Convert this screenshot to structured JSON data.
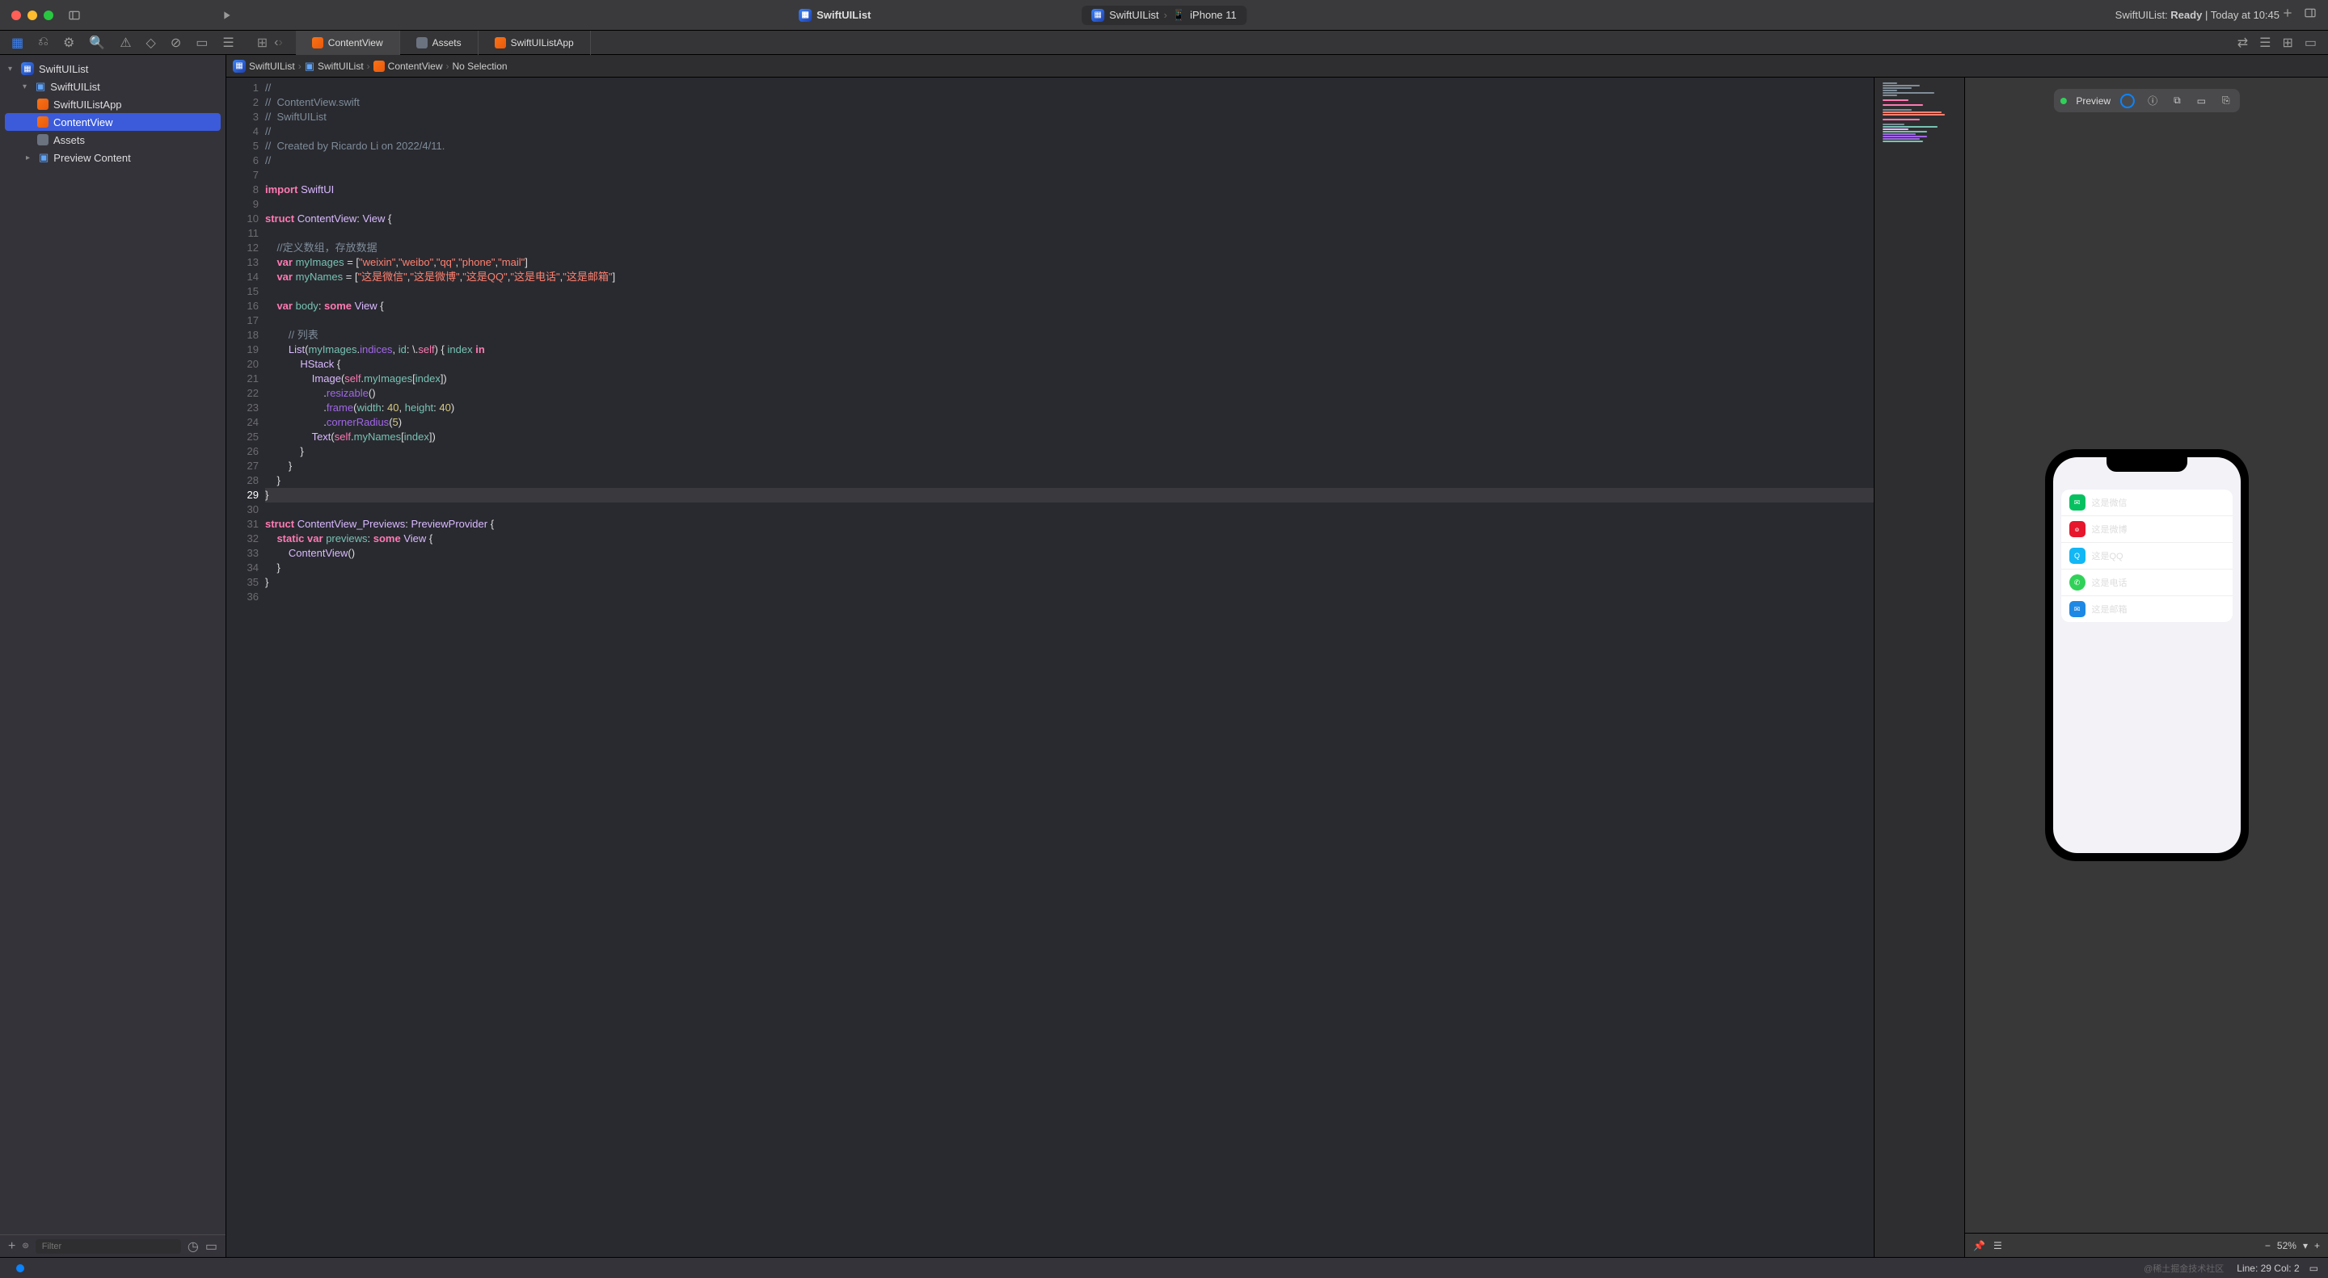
{
  "titlebar": {
    "project_name": "SwiftUIList",
    "scheme": "SwiftUIList",
    "device": "iPhone 11",
    "status_prefix": "SwiftUIList:",
    "status_ready": "Ready",
    "status_time": "| Today at 10:45"
  },
  "tabs": [
    {
      "label": "ContentView",
      "icon": "swift",
      "active": true
    },
    {
      "label": "Assets",
      "icon": "assets",
      "active": false
    },
    {
      "label": "SwiftUIListApp",
      "icon": "swift",
      "active": false
    }
  ],
  "breadcrumb": {
    "items": [
      "SwiftUIList",
      "SwiftUIList",
      "ContentView",
      "No Selection"
    ]
  },
  "navigator": {
    "root": "SwiftUIList",
    "group": "SwiftUIList",
    "files": [
      {
        "name": "SwiftUIListApp",
        "icon": "swift"
      },
      {
        "name": "ContentView",
        "icon": "swift",
        "selected": true
      },
      {
        "name": "Assets",
        "icon": "assets"
      },
      {
        "name": "Preview Content",
        "icon": "folder"
      }
    ],
    "filter_placeholder": "Filter"
  },
  "code": {
    "lines": [
      "//",
      "//  ContentView.swift",
      "//  SwiftUIList",
      "//",
      "//  Created by Ricardo Li on 2022/4/11.",
      "//",
      "",
      "import SwiftUI",
      "",
      "struct ContentView: View {",
      "",
      "    //定义数组，存放数据",
      "    var myImages = [\"weixin\",\"weibo\",\"qq\",\"phone\",\"mail\"]",
      "    var myNames = [\"这是微信\",\"这是微博\",\"这是QQ\",\"这是电话\",\"这是邮箱\"]",
      "",
      "    var body: some View {",
      "",
      "        // 列表",
      "        List(myImages.indices, id: \\.self) { index in",
      "            HStack {",
      "                Image(self.myImages[index])",
      "                    .resizable()",
      "                    .frame(width: 40, height: 40)",
      "                    .cornerRadius(5)",
      "                Text(self.myNames[index])",
      "            }",
      "        }",
      "    }",
      "}",
      "",
      "struct ContentView_Previews: PreviewProvider {",
      "    static var previews: some View {",
      "        ContentView()",
      "    }",
      "}",
      ""
    ],
    "current_line": 29
  },
  "preview": {
    "label": "Preview",
    "zoom": "52%",
    "list_items": [
      {
        "icon": "wx",
        "text": "这是微信"
      },
      {
        "icon": "wb",
        "text": "这是微博"
      },
      {
        "icon": "qq",
        "text": "这是QQ"
      },
      {
        "icon": "ph",
        "text": "这是电话"
      },
      {
        "icon": "ml",
        "text": "这是邮箱"
      }
    ]
  },
  "statusbar": {
    "watermark": "@稀土掘金技术社区",
    "line_col": "Line: 29  Col: 2"
  }
}
